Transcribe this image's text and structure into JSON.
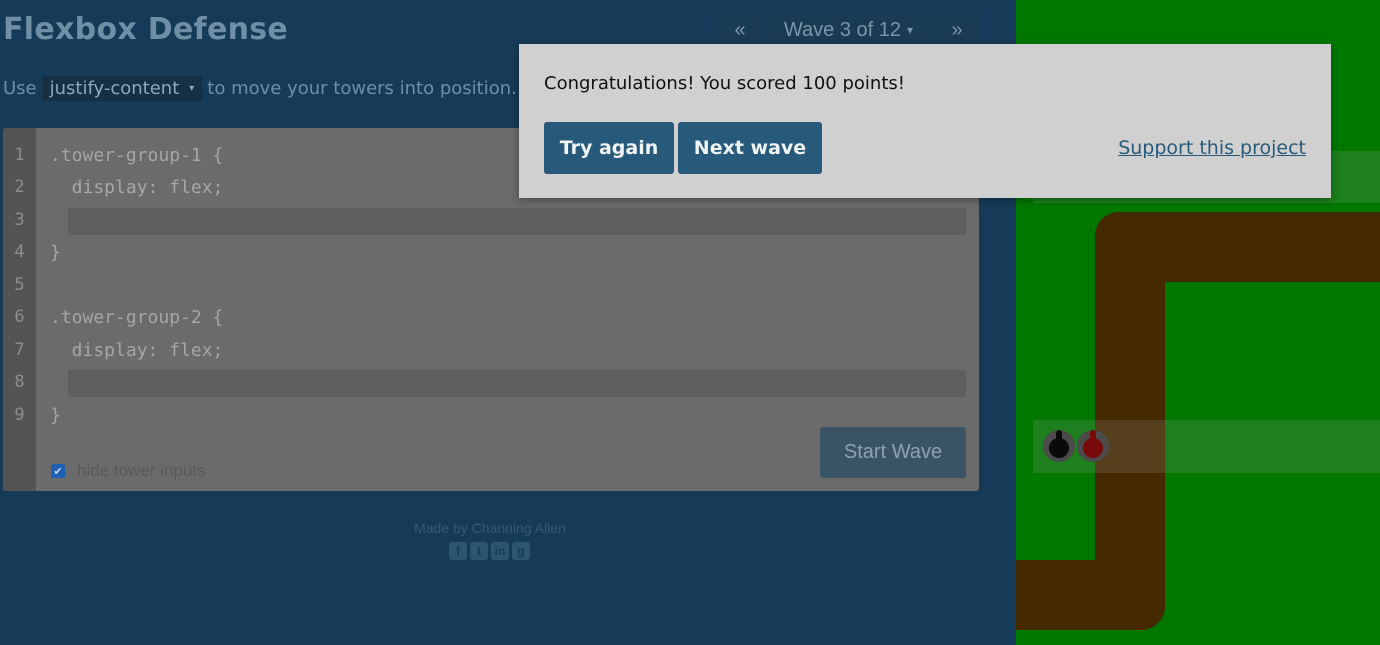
{
  "header": {
    "title": "Flexbox Defense",
    "prev_label": "«",
    "next_label": "»",
    "wave_label": "Wave 3 of 12",
    "wave_caret": "▾"
  },
  "instructions": {
    "prefix": "Use",
    "property": "justify-content",
    "property_caret": "▾",
    "suffix": "to move your towers into position."
  },
  "editor": {
    "line_numbers": [
      "1",
      "2",
      "3",
      "4",
      "5",
      "6",
      "7",
      "8",
      "9"
    ],
    "lines": [
      ".tower-group-1 {",
      "  display: flex;",
      "",
      "}",
      "",
      ".tower-group-2 {",
      "  display: flex;",
      "",
      "}"
    ],
    "input_1_value": "",
    "input_2_value": "",
    "hide_inputs_label": "hide tower inputs",
    "hide_inputs_checked": true,
    "start_wave_label": "Start Wave"
  },
  "footer": {
    "credit": "Made by Channing Allen",
    "social_icons": [
      "facebook-icon",
      "twitter-icon",
      "linkedin-icon",
      "github-icon"
    ]
  },
  "modal": {
    "message": "Congratulations! You scored 100 points!",
    "try_again_label": "Try again",
    "next_wave_label": "Next wave",
    "support_label": "Support this project"
  },
  "board": {
    "towers": [
      {
        "group": "tower-group-2",
        "color": "#0a0a0a"
      },
      {
        "group": "tower-group-2",
        "color": "#7a0a0a"
      }
    ],
    "colors": {
      "grass": "#007800",
      "path": "#452a01",
      "accent": "#275a7a"
    }
  }
}
